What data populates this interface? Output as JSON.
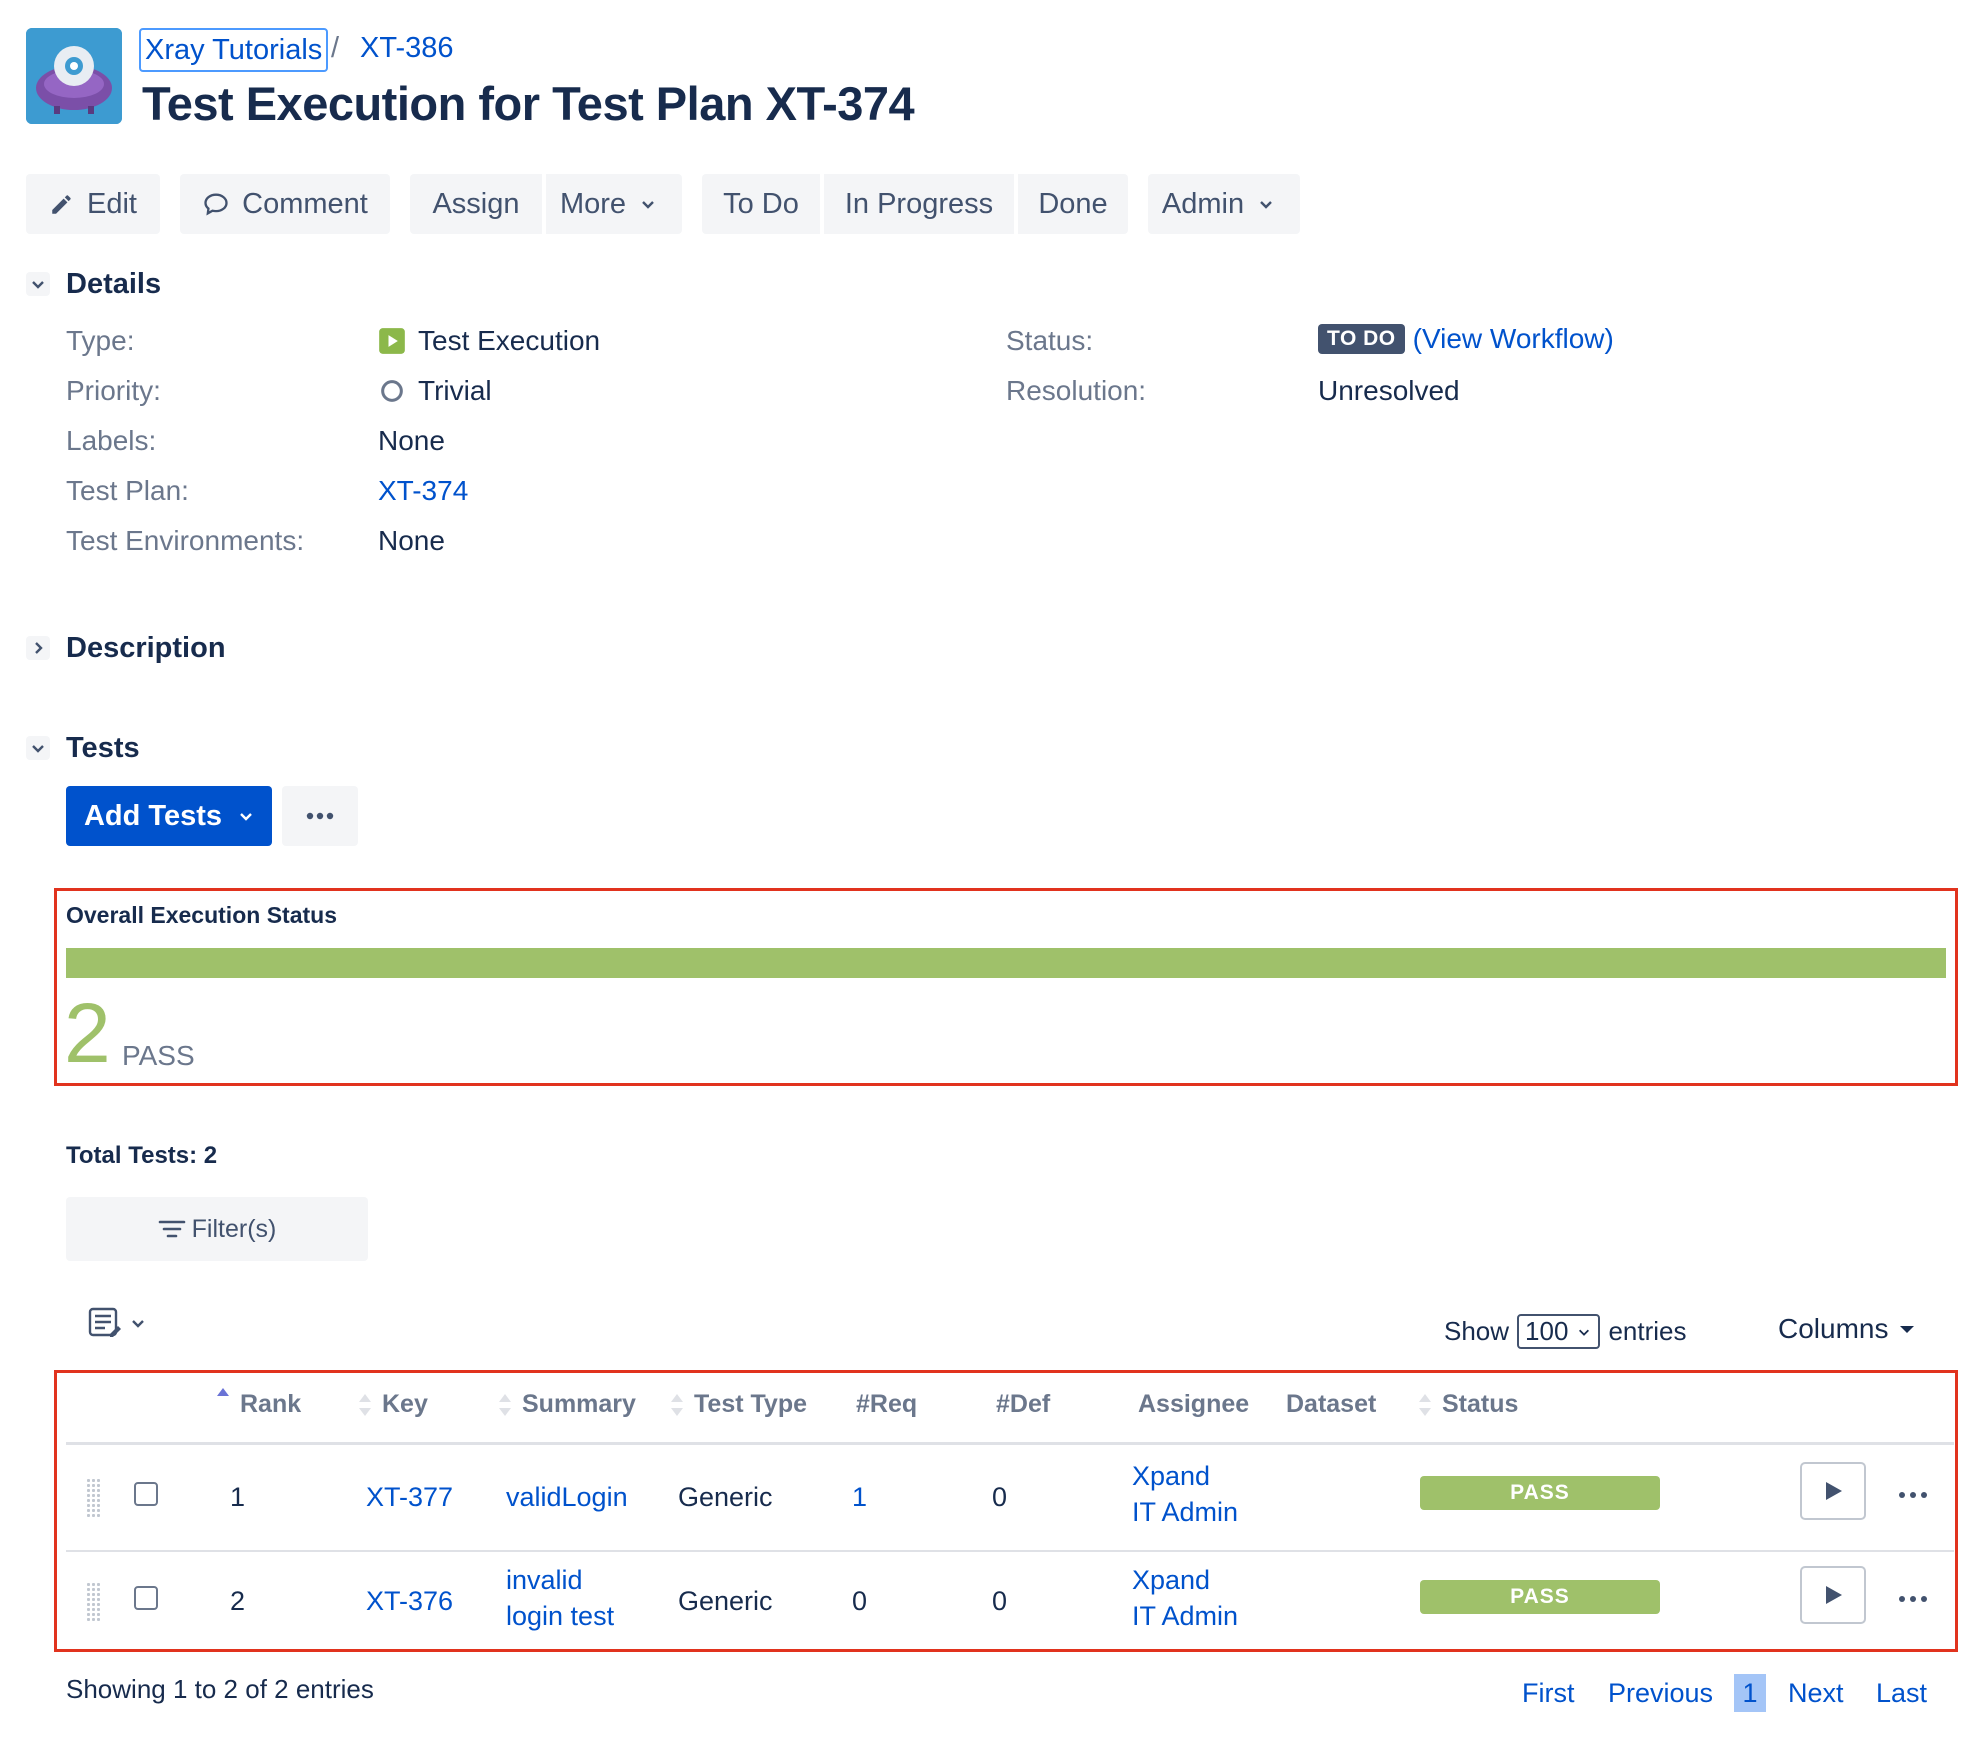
{
  "breadcrumb": {
    "project": "Xray Tutorials",
    "separator": "/",
    "issue_key": "XT-386"
  },
  "page_title": "Test Execution for Test Plan XT-374",
  "toolbar": {
    "edit": "Edit",
    "comment": "Comment",
    "assign": "Assign",
    "more": "More",
    "todo": "To Do",
    "in_progress": "In Progress",
    "done": "Done",
    "admin": "Admin"
  },
  "details": {
    "heading": "Details",
    "type_label": "Type:",
    "type_value": "Test Execution",
    "priority_label": "Priority:",
    "priority_value": "Trivial",
    "labels_label": "Labels:",
    "labels_value": "None",
    "test_plan_label": "Test Plan:",
    "test_plan_value": "XT-374",
    "test_env_label": "Test Environments:",
    "test_env_value": "None",
    "status_label": "Status:",
    "status_badge": "TO DO",
    "status_open": "(",
    "view_workflow": "View Workflow",
    "status_close": ")",
    "resolution_label": "Resolution:",
    "resolution_value": "Unresolved"
  },
  "description": {
    "heading": "Description"
  },
  "tests": {
    "heading": "Tests",
    "add_tests": "Add Tests",
    "overall_title": "Overall Execution Status",
    "pass_fraction": 1.0,
    "pass_count": "2",
    "pass_label": "PASS",
    "total_tests": "Total Tests: 2",
    "filters": "Filter(s)",
    "show_label": "Show",
    "entries_value": "100",
    "entries_label": "entries",
    "columns": "Columns",
    "headers": {
      "rank": "Rank",
      "key": "Key",
      "summary": "Summary",
      "test_type": "Test Type",
      "req": "#Req",
      "def": "#Def",
      "assignee": "Assignee",
      "dataset": "Dataset",
      "status": "Status"
    },
    "rows": [
      {
        "rank": "1",
        "key": "XT-377",
        "summary_1": "validLogin",
        "summary_2": "",
        "test_type": "Generic",
        "req": "1",
        "def": "0",
        "assignee_1": "Xpand",
        "assignee_2": "IT Admin",
        "status": "PASS"
      },
      {
        "rank": "2",
        "key": "XT-376",
        "summary_1": "invalid",
        "summary_2": "login test",
        "test_type": "Generic",
        "req": "0",
        "def": "0",
        "assignee_1": "Xpand",
        "assignee_2": "IT Admin",
        "status": "PASS"
      }
    ],
    "showing": "Showing 1 to 2 of 2 entries",
    "pagination": {
      "first": "First",
      "previous": "Previous",
      "current": "1",
      "next": "Next",
      "last": "Last"
    }
  },
  "colors": {
    "accent": "#0052cc",
    "pass": "#9fc16a",
    "highlight": "#e1331e",
    "todo_badge": "#42526e"
  }
}
